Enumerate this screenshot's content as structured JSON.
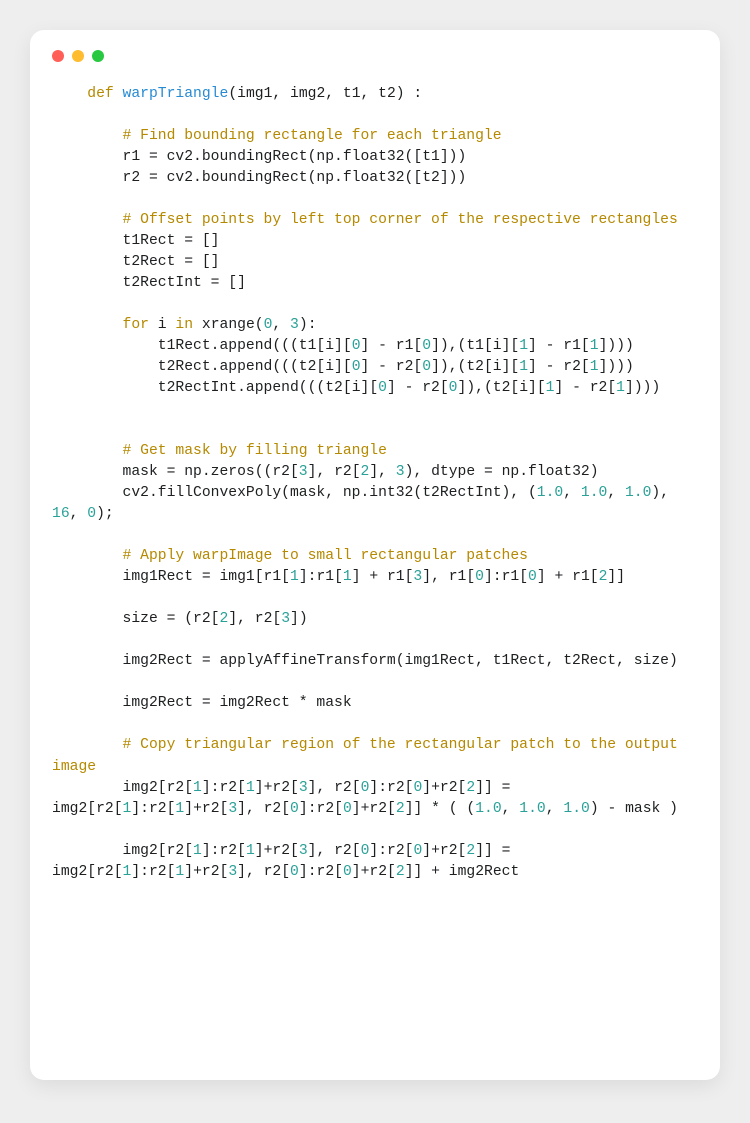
{
  "code": {
    "tokens": [
      {
        "t": "plain",
        "v": "    "
      },
      {
        "t": "kw",
        "v": "def"
      },
      {
        "t": "plain",
        "v": " "
      },
      {
        "t": "def",
        "v": "warpTriangle"
      },
      {
        "t": "plain",
        "v": "(img1, img2, t1, t2) :"
      },
      {
        "t": "nl"
      },
      {
        "t": "nl"
      },
      {
        "t": "plain",
        "v": "        "
      },
      {
        "t": "com",
        "v": "# Find bounding rectangle for each triangle"
      },
      {
        "t": "nl"
      },
      {
        "t": "plain",
        "v": "        r1 = cv2.boundingRect(np.float32([t1]))"
      },
      {
        "t": "nl"
      },
      {
        "t": "plain",
        "v": "        r2 = cv2.boundingRect(np.float32([t2]))"
      },
      {
        "t": "nl"
      },
      {
        "t": "nl"
      },
      {
        "t": "plain",
        "v": "        "
      },
      {
        "t": "com",
        "v": "# Offset points by left top corner of the respective rectangles"
      },
      {
        "t": "nl"
      },
      {
        "t": "plain",
        "v": "        t1Rect = []"
      },
      {
        "t": "nl"
      },
      {
        "t": "plain",
        "v": "        t2Rect = []"
      },
      {
        "t": "nl"
      },
      {
        "t": "plain",
        "v": "        t2RectInt = []"
      },
      {
        "t": "nl"
      },
      {
        "t": "nl"
      },
      {
        "t": "plain",
        "v": "        "
      },
      {
        "t": "kw",
        "v": "for"
      },
      {
        "t": "plain",
        "v": " i "
      },
      {
        "t": "kw",
        "v": "in"
      },
      {
        "t": "plain",
        "v": " xrange("
      },
      {
        "t": "num",
        "v": "0"
      },
      {
        "t": "plain",
        "v": ", "
      },
      {
        "t": "num",
        "v": "3"
      },
      {
        "t": "plain",
        "v": "):"
      },
      {
        "t": "nl"
      },
      {
        "t": "plain",
        "v": "            t1Rect.append(((t1[i]["
      },
      {
        "t": "num",
        "v": "0"
      },
      {
        "t": "plain",
        "v": "] - r1["
      },
      {
        "t": "num",
        "v": "0"
      },
      {
        "t": "plain",
        "v": "]),(t1[i]["
      },
      {
        "t": "num",
        "v": "1"
      },
      {
        "t": "plain",
        "v": "] - r1["
      },
      {
        "t": "num",
        "v": "1"
      },
      {
        "t": "plain",
        "v": "])))"
      },
      {
        "t": "nl"
      },
      {
        "t": "plain",
        "v": "            t2Rect.append(((t2[i]["
      },
      {
        "t": "num",
        "v": "0"
      },
      {
        "t": "plain",
        "v": "] - r2["
      },
      {
        "t": "num",
        "v": "0"
      },
      {
        "t": "plain",
        "v": "]),(t2[i]["
      },
      {
        "t": "num",
        "v": "1"
      },
      {
        "t": "plain",
        "v": "] - r2["
      },
      {
        "t": "num",
        "v": "1"
      },
      {
        "t": "plain",
        "v": "])))"
      },
      {
        "t": "nl"
      },
      {
        "t": "plain",
        "v": "            t2RectInt.append(((t2[i]["
      },
      {
        "t": "num",
        "v": "0"
      },
      {
        "t": "plain",
        "v": "] - r2["
      },
      {
        "t": "num",
        "v": "0"
      },
      {
        "t": "plain",
        "v": "]),(t2[i]["
      },
      {
        "t": "num",
        "v": "1"
      },
      {
        "t": "plain",
        "v": "] - r2["
      },
      {
        "t": "num",
        "v": "1"
      },
      {
        "t": "plain",
        "v": "])))"
      },
      {
        "t": "nl"
      },
      {
        "t": "nl"
      },
      {
        "t": "nl"
      },
      {
        "t": "plain",
        "v": "        "
      },
      {
        "t": "com",
        "v": "# Get mask by filling triangle"
      },
      {
        "t": "nl"
      },
      {
        "t": "plain",
        "v": "        mask = np.zeros((r2["
      },
      {
        "t": "num",
        "v": "3"
      },
      {
        "t": "plain",
        "v": "], r2["
      },
      {
        "t": "num",
        "v": "2"
      },
      {
        "t": "plain",
        "v": "], "
      },
      {
        "t": "num",
        "v": "3"
      },
      {
        "t": "plain",
        "v": "), dtype = np.float32)"
      },
      {
        "t": "nl"
      },
      {
        "t": "plain",
        "v": "        cv2.fillConvexPoly(mask, np.int32(t2RectInt), ("
      },
      {
        "t": "num",
        "v": "1.0"
      },
      {
        "t": "plain",
        "v": ", "
      },
      {
        "t": "num",
        "v": "1.0"
      },
      {
        "t": "plain",
        "v": ", "
      },
      {
        "t": "num",
        "v": "1.0"
      },
      {
        "t": "plain",
        "v": "), "
      },
      {
        "t": "num",
        "v": "16"
      },
      {
        "t": "plain",
        "v": ", "
      },
      {
        "t": "num",
        "v": "0"
      },
      {
        "t": "plain",
        "v": ");"
      },
      {
        "t": "nl"
      },
      {
        "t": "nl"
      },
      {
        "t": "plain",
        "v": "        "
      },
      {
        "t": "com",
        "v": "# Apply warpImage to small rectangular patches"
      },
      {
        "t": "nl"
      },
      {
        "t": "plain",
        "v": "        img1Rect = img1[r1["
      },
      {
        "t": "num",
        "v": "1"
      },
      {
        "t": "plain",
        "v": "]:r1["
      },
      {
        "t": "num",
        "v": "1"
      },
      {
        "t": "plain",
        "v": "] + r1["
      },
      {
        "t": "num",
        "v": "3"
      },
      {
        "t": "plain",
        "v": "], r1["
      },
      {
        "t": "num",
        "v": "0"
      },
      {
        "t": "plain",
        "v": "]:r1["
      },
      {
        "t": "num",
        "v": "0"
      },
      {
        "t": "plain",
        "v": "] + r1["
      },
      {
        "t": "num",
        "v": "2"
      },
      {
        "t": "plain",
        "v": "]]"
      },
      {
        "t": "nl"
      },
      {
        "t": "nl"
      },
      {
        "t": "plain",
        "v": "        size = (r2["
      },
      {
        "t": "num",
        "v": "2"
      },
      {
        "t": "plain",
        "v": "], r2["
      },
      {
        "t": "num",
        "v": "3"
      },
      {
        "t": "plain",
        "v": "])"
      },
      {
        "t": "nl"
      },
      {
        "t": "nl"
      },
      {
        "t": "plain",
        "v": "        img2Rect = applyAffineTransform(img1Rect, t1Rect, t2Rect, size)"
      },
      {
        "t": "nl"
      },
      {
        "t": "nl"
      },
      {
        "t": "plain",
        "v": "        img2Rect = img2Rect * mask"
      },
      {
        "t": "nl"
      },
      {
        "t": "nl"
      },
      {
        "t": "plain",
        "v": "        "
      },
      {
        "t": "com",
        "v": "# Copy triangular region of the rectangular patch to the output image"
      },
      {
        "t": "nl"
      },
      {
        "t": "plain",
        "v": "        img2[r2["
      },
      {
        "t": "num",
        "v": "1"
      },
      {
        "t": "plain",
        "v": "]:r2["
      },
      {
        "t": "num",
        "v": "1"
      },
      {
        "t": "plain",
        "v": "]+r2["
      },
      {
        "t": "num",
        "v": "3"
      },
      {
        "t": "plain",
        "v": "], r2["
      },
      {
        "t": "num",
        "v": "0"
      },
      {
        "t": "plain",
        "v": "]:r2["
      },
      {
        "t": "num",
        "v": "0"
      },
      {
        "t": "plain",
        "v": "]+r2["
      },
      {
        "t": "num",
        "v": "2"
      },
      {
        "t": "plain",
        "v": "]] = img2[r2["
      },
      {
        "t": "num",
        "v": "1"
      },
      {
        "t": "plain",
        "v": "]:r2["
      },
      {
        "t": "num",
        "v": "1"
      },
      {
        "t": "plain",
        "v": "]+r2["
      },
      {
        "t": "num",
        "v": "3"
      },
      {
        "t": "plain",
        "v": "], r2["
      },
      {
        "t": "num",
        "v": "0"
      },
      {
        "t": "plain",
        "v": "]:r2["
      },
      {
        "t": "num",
        "v": "0"
      },
      {
        "t": "plain",
        "v": "]+r2["
      },
      {
        "t": "num",
        "v": "2"
      },
      {
        "t": "plain",
        "v": "]] * ( ("
      },
      {
        "t": "num",
        "v": "1.0"
      },
      {
        "t": "plain",
        "v": ", "
      },
      {
        "t": "num",
        "v": "1.0"
      },
      {
        "t": "plain",
        "v": ", "
      },
      {
        "t": "num",
        "v": "1.0"
      },
      {
        "t": "plain",
        "v": ") - mask )"
      },
      {
        "t": "nl"
      },
      {
        "t": "nl"
      },
      {
        "t": "plain",
        "v": "        img2[r2["
      },
      {
        "t": "num",
        "v": "1"
      },
      {
        "t": "plain",
        "v": "]:r2["
      },
      {
        "t": "num",
        "v": "1"
      },
      {
        "t": "plain",
        "v": "]+r2["
      },
      {
        "t": "num",
        "v": "3"
      },
      {
        "t": "plain",
        "v": "], r2["
      },
      {
        "t": "num",
        "v": "0"
      },
      {
        "t": "plain",
        "v": "]:r2["
      },
      {
        "t": "num",
        "v": "0"
      },
      {
        "t": "plain",
        "v": "]+r2["
      },
      {
        "t": "num",
        "v": "2"
      },
      {
        "t": "plain",
        "v": "]] = img2[r2["
      },
      {
        "t": "num",
        "v": "1"
      },
      {
        "t": "plain",
        "v": "]:r2["
      },
      {
        "t": "num",
        "v": "1"
      },
      {
        "t": "plain",
        "v": "]+r2["
      },
      {
        "t": "num",
        "v": "3"
      },
      {
        "t": "plain",
        "v": "], r2["
      },
      {
        "t": "num",
        "v": "0"
      },
      {
        "t": "plain",
        "v": "]:r2["
      },
      {
        "t": "num",
        "v": "0"
      },
      {
        "t": "plain",
        "v": "]+r2["
      },
      {
        "t": "num",
        "v": "2"
      },
      {
        "t": "plain",
        "v": "]] + img2Rect"
      },
      {
        "t": "nl"
      }
    ]
  }
}
